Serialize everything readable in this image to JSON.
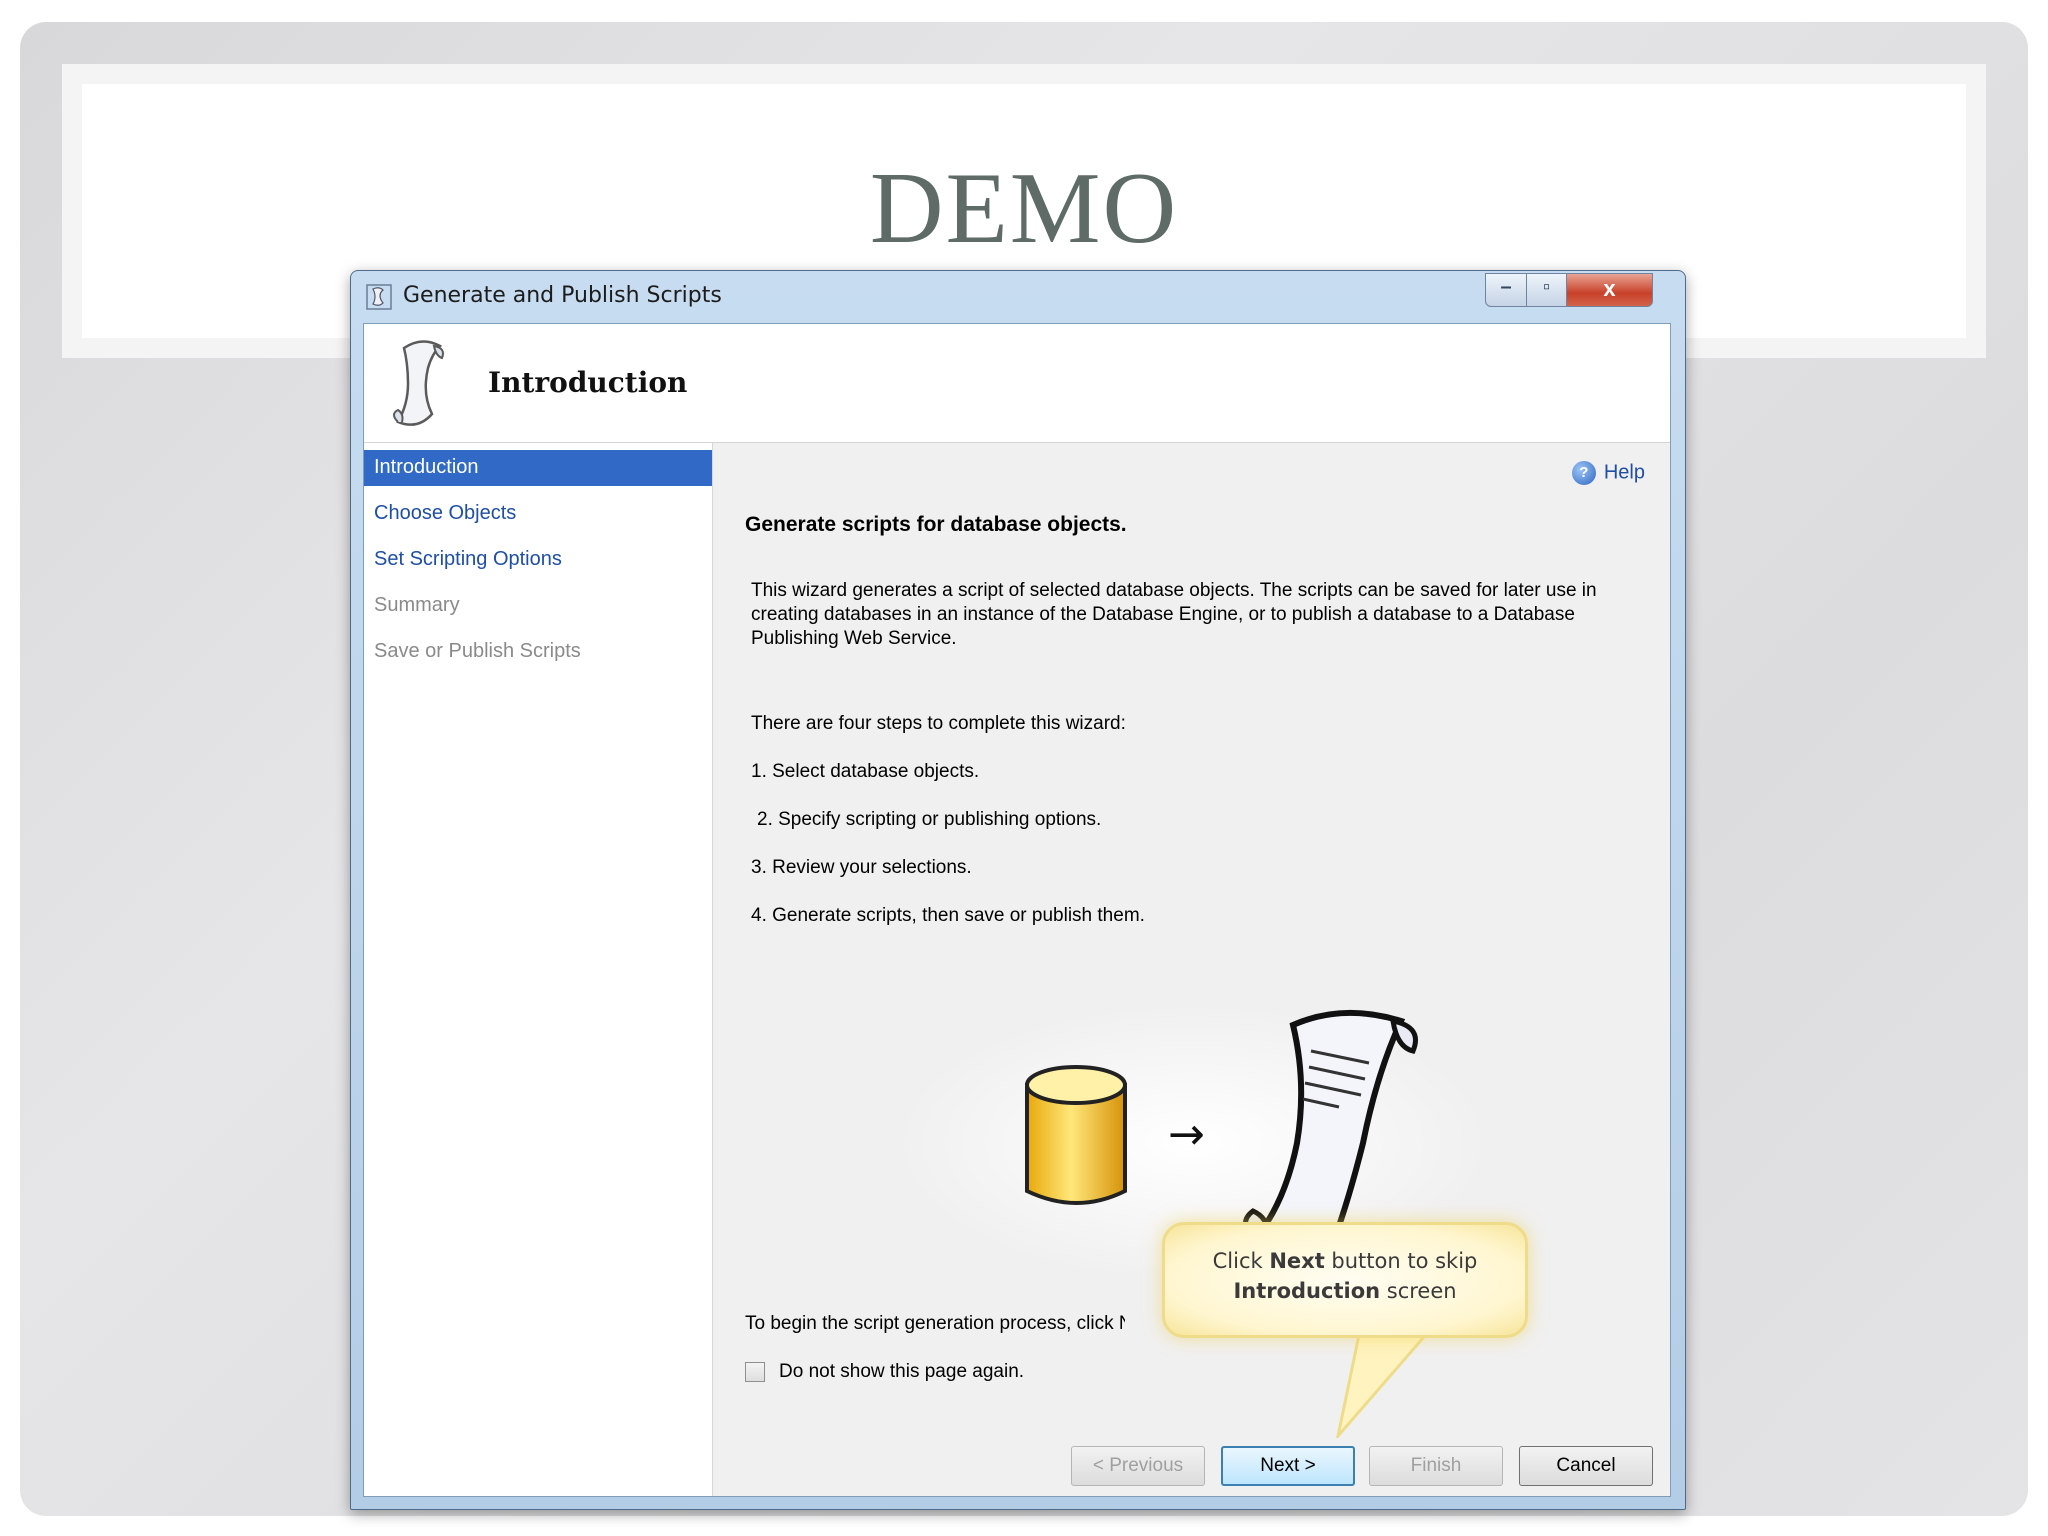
{
  "slide": {
    "title": "DEMO"
  },
  "window": {
    "title": "Generate and Publish Scripts",
    "controls": {
      "minimize": "–",
      "maximize": "▫",
      "close": "x"
    }
  },
  "header": {
    "title": "Introduction"
  },
  "nav": {
    "items": [
      {
        "label": "Introduction",
        "state": "active"
      },
      {
        "label": "Choose Objects",
        "state": "link"
      },
      {
        "label": "Set Scripting Options",
        "state": "link"
      },
      {
        "label": "Summary",
        "state": "disabled"
      },
      {
        "label": "Save or Publish Scripts",
        "state": "disabled"
      }
    ]
  },
  "main": {
    "help_label": "Help",
    "heading": "Generate scripts for database objects.",
    "description": "This wizard generates a script of selected database objects. The scripts can be saved for later use in creating databases in an instance of the Database Engine, or to publish a database to a Database Publishing Web Service.",
    "steps_intro": "There are four steps to complete this wizard:",
    "steps": [
      "1. Select database objects.",
      "2. Specify scripting or publishing options.",
      "3. Review your selections.",
      "4. Generate scripts, then save or publish them."
    ],
    "begin_text": "To begin the script generation process, click Ne",
    "checkbox_label": "Do not show this page again.",
    "arrow": "→"
  },
  "buttons": {
    "previous": "< Previous",
    "next": "Next >",
    "finish": "Finish",
    "cancel": "Cancel"
  },
  "callout": {
    "line1_pre": "Click ",
    "line1_bold": "Next",
    "line1_post": " button to skip",
    "line2_bold": "Introduction",
    "line2_post": " screen"
  },
  "colors": {
    "selection": "#3169c6",
    "link": "#1f4ea3",
    "slide_title": "#5e6b66",
    "callout_border": "#eedc8a"
  }
}
